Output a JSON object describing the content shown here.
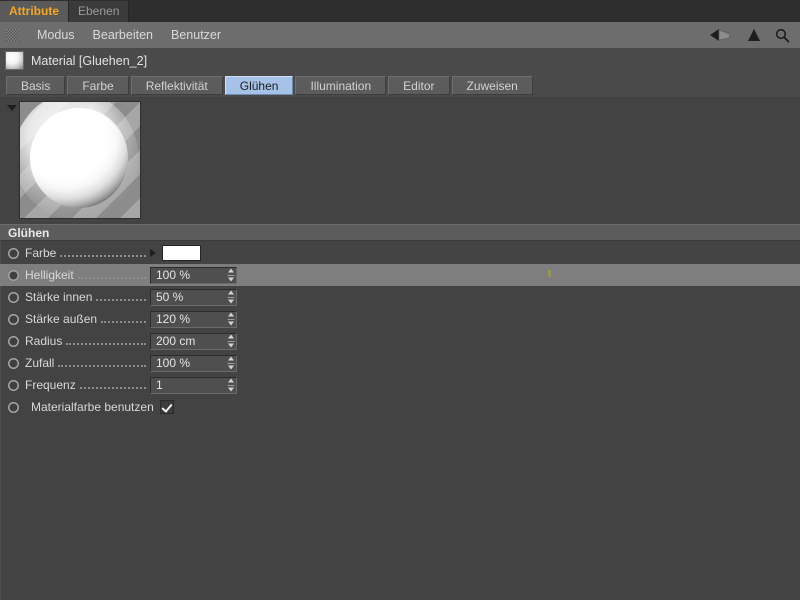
{
  "panel_tabs": [
    {
      "label": "Attribute",
      "active": true
    },
    {
      "label": "Ebenen",
      "active": false
    }
  ],
  "menubar": {
    "grip_icon": "drag-grip-icon",
    "items": [
      "Modus",
      "Bearbeiten",
      "Benutzer"
    ],
    "right_icons": [
      "back-arrow-icon",
      "up-arrow-icon",
      "search-icon"
    ]
  },
  "object_title": {
    "icon": "material-sphere-icon",
    "text": "Material [Gluehen_2]"
  },
  "attribute_tabs": [
    {
      "label": "Basis",
      "selected": false
    },
    {
      "label": "Farbe",
      "selected": false
    },
    {
      "label": "Reflektivität",
      "selected": false
    },
    {
      "label": "Glühen",
      "selected": true
    },
    {
      "label": "Illumination",
      "selected": false
    },
    {
      "label": "Editor",
      "selected": false
    },
    {
      "label": "Zuweisen",
      "selected": false
    }
  ],
  "preview": {
    "collapse_icon": "collapse-triangle-icon",
    "content": "material-preview-sphere"
  },
  "section": {
    "title": "Glühen"
  },
  "parameters": {
    "farbe": {
      "label": "Farbe",
      "expand_icon": "expand-triangle-icon",
      "color": "#ffffff"
    },
    "helligkeit": {
      "label": "Helligkeit",
      "value": "100 %",
      "highlighted": true
    },
    "staerke_innen": {
      "label": "Stärke innen",
      "value": "50 %"
    },
    "staerke_aussen": {
      "label": "Stärke außen",
      "value": "120 %"
    },
    "radius": {
      "label": "Radius",
      "value": "200 cm"
    },
    "zufall": {
      "label": "Zufall",
      "value": "100 %"
    },
    "frequenz": {
      "label": "Frequenz",
      "value": "1"
    },
    "materialfarbe": {
      "label": "Materialfarbe benutzen",
      "checked": true
    }
  },
  "colors": {
    "panel_bg": "#434343",
    "menubar_bg": "#6d6d6d",
    "tab_active_text": "#f5a623",
    "tab_selected_bg": "#a7c2e8",
    "row_highlight": "#7e7e7e",
    "section_header_bg": "#5c5c5c"
  }
}
